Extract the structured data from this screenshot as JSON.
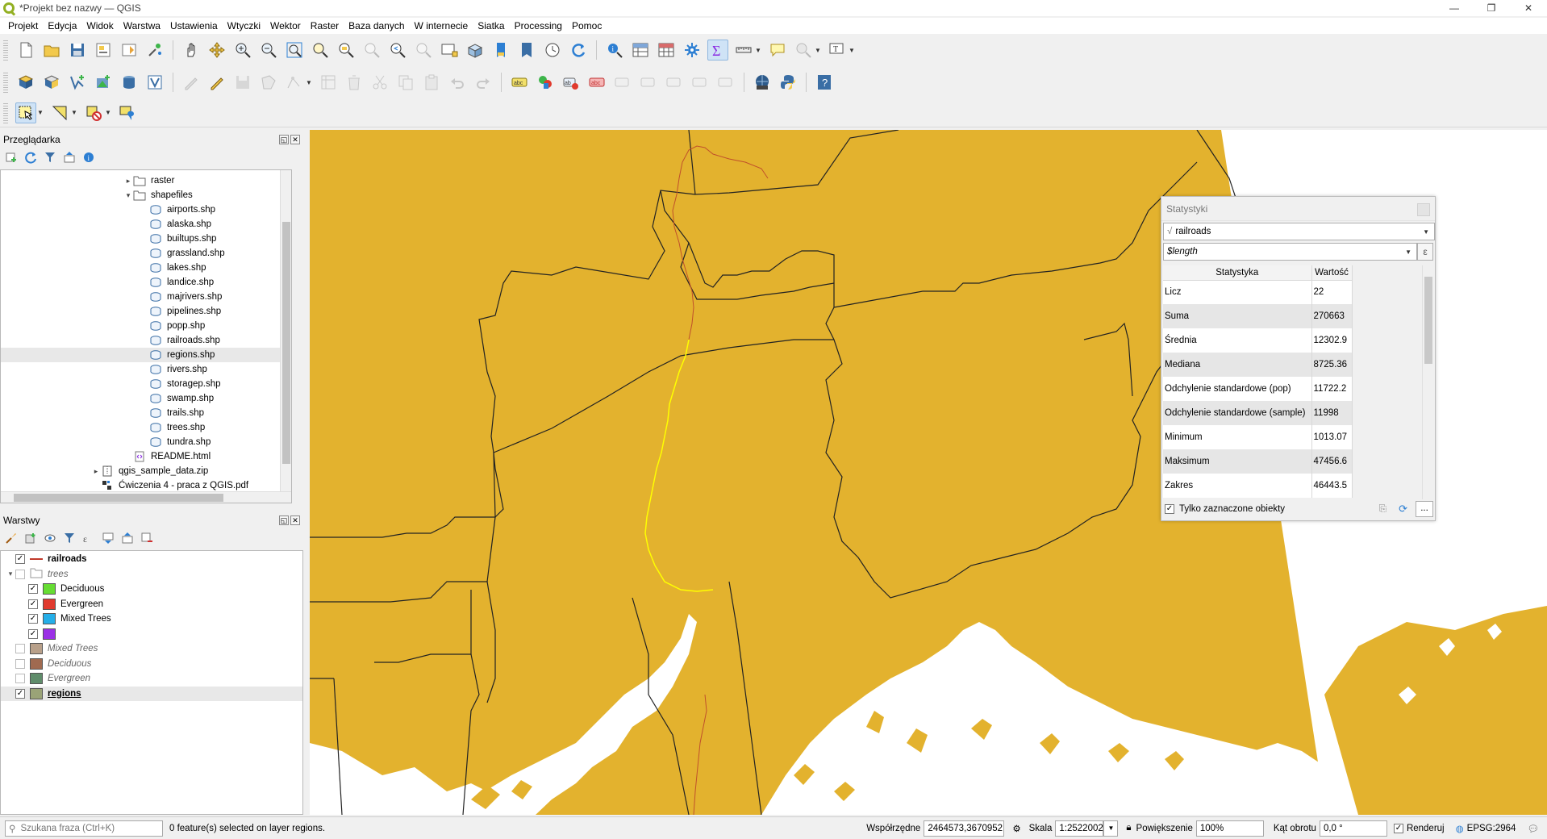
{
  "window": {
    "title": "*Projekt bez nazwy — QGIS",
    "controls": [
      "—",
      "❐",
      "✕"
    ]
  },
  "menu": [
    "Projekt",
    "Edycja",
    "Widok",
    "Warstwa",
    "Ustawienia",
    "Wtyczki",
    "Wektor",
    "Raster",
    "Baza danych",
    "W internecie",
    "Siatka",
    "Processing",
    "Pomoc"
  ],
  "browser": {
    "title": "Przeglądarka",
    "items": [
      {
        "label": "raster",
        "icon": "folder-icon",
        "expanded": false,
        "level": 1
      },
      {
        "label": "shapefiles",
        "icon": "folder-icon",
        "expanded": true,
        "level": 1
      },
      {
        "label": "airports.shp",
        "icon": "shapefile-icon",
        "level": 2
      },
      {
        "label": "alaska.shp",
        "icon": "shapefile-icon",
        "level": 2
      },
      {
        "label": "builtups.shp",
        "icon": "shapefile-icon",
        "level": 2
      },
      {
        "label": "grassland.shp",
        "icon": "shapefile-icon",
        "level": 2
      },
      {
        "label": "lakes.shp",
        "icon": "shapefile-icon",
        "level": 2
      },
      {
        "label": "landice.shp",
        "icon": "shapefile-icon",
        "level": 2
      },
      {
        "label": "majrivers.shp",
        "icon": "shapefile-icon",
        "level": 2
      },
      {
        "label": "pipelines.shp",
        "icon": "shapefile-icon",
        "level": 2
      },
      {
        "label": "popp.shp",
        "icon": "shapefile-icon",
        "level": 2
      },
      {
        "label": "railroads.shp",
        "icon": "shapefile-icon",
        "level": 2
      },
      {
        "label": "regions.shp",
        "icon": "shapefile-icon",
        "level": 2,
        "selected": true
      },
      {
        "label": "rivers.shp",
        "icon": "shapefile-icon",
        "level": 2
      },
      {
        "label": "storagep.shp",
        "icon": "shapefile-icon",
        "level": 2
      },
      {
        "label": "swamp.shp",
        "icon": "shapefile-icon",
        "level": 2
      },
      {
        "label": "trails.shp",
        "icon": "shapefile-icon",
        "level": 2
      },
      {
        "label": "trees.shp",
        "icon": "shapefile-icon",
        "level": 2
      },
      {
        "label": "tundra.shp",
        "icon": "shapefile-icon",
        "level": 2
      },
      {
        "label": "README.html",
        "icon": "html-file-icon",
        "level": 1
      },
      {
        "label": "qgis_sample_data.zip",
        "icon": "zip-icon",
        "level": 0,
        "collapsed_arrow": true
      },
      {
        "label": "Ćwiczenia 4 - praca z QGIS.pdf",
        "icon": "pdf-icon",
        "level": 0
      }
    ]
  },
  "layers": {
    "title": "Warstwy",
    "items": [
      {
        "label": "railroads",
        "checked": true,
        "style": "bold",
        "symbol": "line",
        "color": "#c0392b",
        "indent": 0
      },
      {
        "label": "trees",
        "checked": false,
        "style": "italic",
        "symbol": "group",
        "indent": 0,
        "expanded": true
      },
      {
        "label": "Deciduous",
        "checked": true,
        "style": "normal",
        "symbol": "fill",
        "color": "#66dd33",
        "indent": 2
      },
      {
        "label": "Evergreen",
        "checked": true,
        "style": "normal",
        "symbol": "fill",
        "color": "#e03a2e",
        "indent": 2
      },
      {
        "label": "Mixed Trees",
        "checked": true,
        "style": "normal",
        "symbol": "fill",
        "color": "#25aee8",
        "indent": 2
      },
      {
        "label": "",
        "checked": true,
        "style": "normal",
        "symbol": "fill",
        "color": "#9b30e6",
        "indent": 2
      },
      {
        "label": "Mixed Trees",
        "checked": false,
        "style": "italic",
        "symbol": "fill",
        "color": "#b8a08a",
        "indent": 1
      },
      {
        "label": "Deciduous",
        "checked": false,
        "style": "italic",
        "symbol": "fill",
        "color": "#a06a50",
        "indent": 1
      },
      {
        "label": "Evergreen",
        "checked": false,
        "style": "italic",
        "symbol": "fill",
        "color": "#5f8c6a",
        "indent": 1
      },
      {
        "label": "regions",
        "checked": true,
        "style": "bold-underline",
        "symbol": "fill",
        "color": "#9aa377",
        "indent": 1,
        "selected": true
      }
    ]
  },
  "stats": {
    "title": "Statystyki",
    "layer": "railroads",
    "field": "$length",
    "col_stat": "Statystyka",
    "col_value": "Wartość",
    "rows": [
      {
        "name": "Licz",
        "value": "22"
      },
      {
        "name": "Suma",
        "value": "270663"
      },
      {
        "name": "Średnia",
        "value": "12302.9"
      },
      {
        "name": "Mediana",
        "value": "8725.36"
      },
      {
        "name": "Odchylenie standardowe (pop)",
        "value": "11722.2"
      },
      {
        "name": "Odchylenie standardowe (sample)",
        "value": "11998"
      },
      {
        "name": "Minimum",
        "value": "1013.07"
      },
      {
        "name": "Maksimum",
        "value": "47456.6"
      },
      {
        "name": "Zakres",
        "value": "46443.5"
      }
    ],
    "only_selected": "Tylko zaznaczone obiekty",
    "more": "..."
  },
  "status": {
    "search_placeholder": "Szukana fraza (Ctrl+K)",
    "message": "0 feature(s) selected on layer regions.",
    "coord_label": "Współrzędne",
    "coord_value": "2464573,3670952",
    "scale_label": "Skala",
    "scale_value": "1:2522002",
    "zoom_label": "Powiększenie",
    "zoom_value": "100%",
    "rotation_label": "Kąt obrotu",
    "rotation_value": "0,0 °",
    "render_label": "Renderuj",
    "crs": "EPSG:2964"
  },
  "colors": {
    "map_fill": "#e3b22e",
    "map_border": "#222222",
    "railroad": "#c0502b",
    "railroad_selected": "#ffff00",
    "accent": "#1e72c8"
  }
}
